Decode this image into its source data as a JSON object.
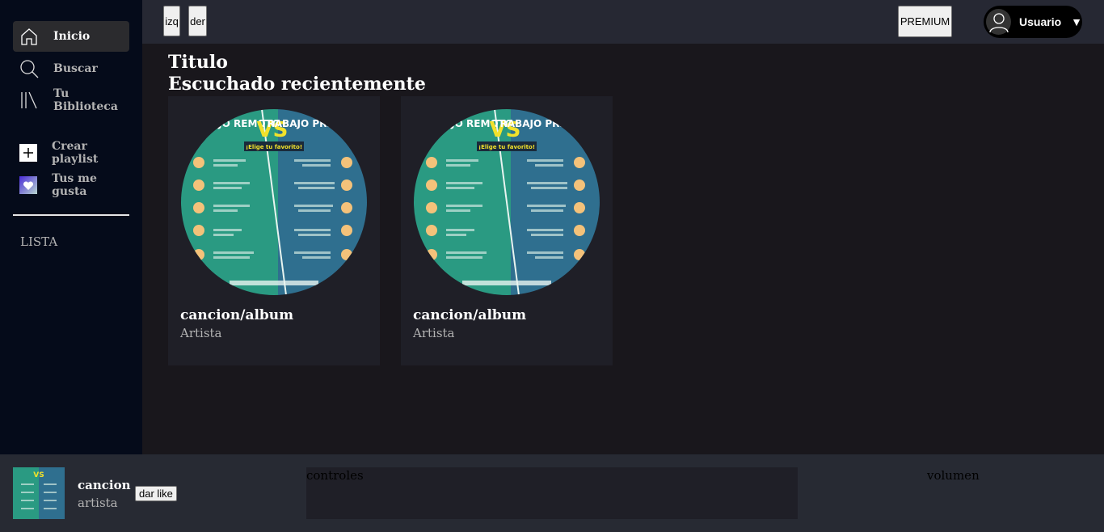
{
  "sidebar": {
    "items": [
      {
        "label": "Inicio",
        "icon": "home-icon",
        "active": true
      },
      {
        "label": "Buscar",
        "icon": "search-icon"
      },
      {
        "label": "Tu Biblioteca",
        "icon": "library-icon"
      },
      {
        "label": "Crear playlist",
        "icon": "plus-icon"
      },
      {
        "label": "Tus me gusta",
        "icon": "heart-icon"
      }
    ],
    "list_label": "LISTA"
  },
  "topbar": {
    "back_label": "izq",
    "forward_label": "der",
    "premium_label": "PREMIUM",
    "user_label": "Usuario"
  },
  "main": {
    "title": "Titulo",
    "section_title": "Escuchado recientemente",
    "cards": [
      {
        "name": "cancion/album",
        "artist": "Artista"
      },
      {
        "name": "cancion/album",
        "artist": "Artista"
      }
    ]
  },
  "cover_art": {
    "left_heading": "TRABAJO REMOTO",
    "vs": "VS",
    "right_heading": "TRABAJO PRESENCIAL",
    "banner": "¡Elige tu favorito!"
  },
  "player": {
    "song": "cancion",
    "artist": "artista",
    "like_label": "dar like",
    "controls_label": "controles",
    "volume_label": "volumen"
  },
  "colors": {
    "sidebar_bg": "#050b1a",
    "topbar_bg": "#262833",
    "main_bg": "#19171c",
    "card_bg": "#1f1f27",
    "player_bg": "#272a33",
    "cover_green": "#2a9a82",
    "cover_blue": "#2f6f8f",
    "accent_purple": "#6a3fd8"
  }
}
